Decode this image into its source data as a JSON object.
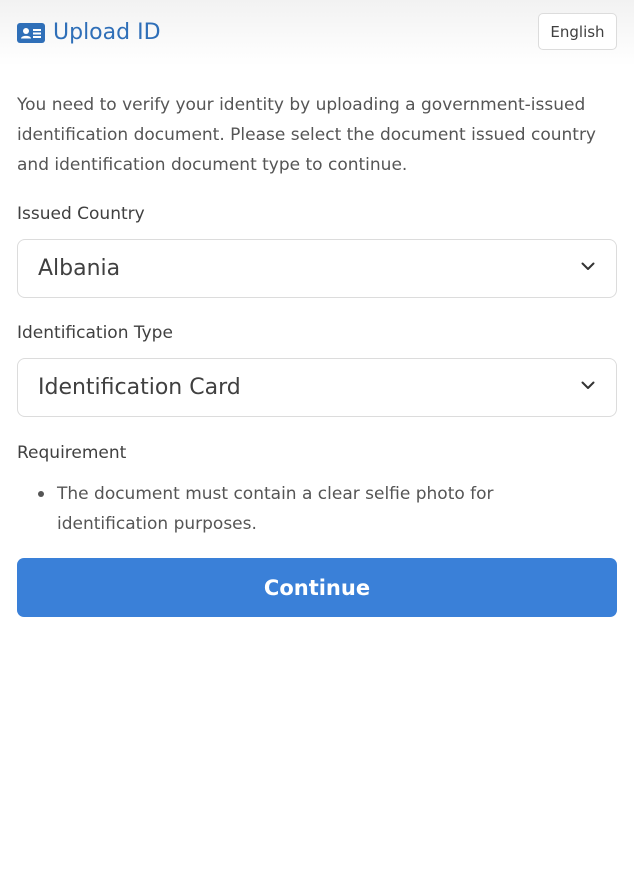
{
  "header": {
    "title": "Upload ID",
    "icon": "id-card-icon",
    "language_button": "English"
  },
  "intro_text": "You need to verify your identity by uploading a government-issued identification document. Please select the document issued country and identification document type to continue.",
  "form": {
    "country": {
      "label": "Issued Country",
      "value": "Albania"
    },
    "id_type": {
      "label": "Identification Type",
      "value": "Identification Card"
    }
  },
  "requirement": {
    "label": "Requirement",
    "items": [
      "The document must contain a clear selfie photo for identification purposes."
    ]
  },
  "continue_label": "Continue",
  "colors": {
    "accent": "#3a80d8",
    "title": "#2f6fb8"
  }
}
